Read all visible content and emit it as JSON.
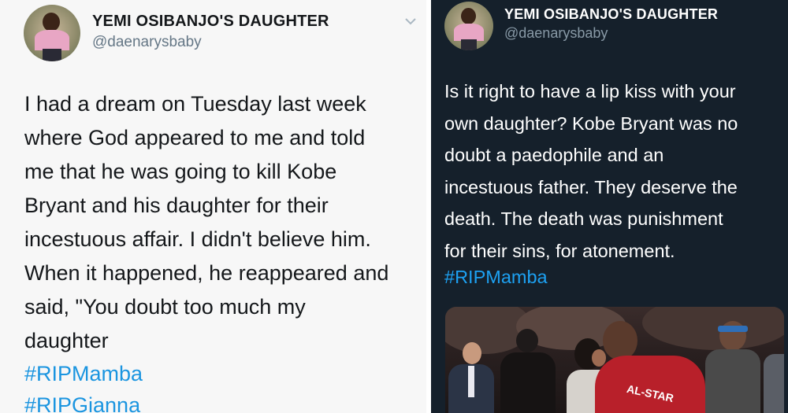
{
  "left_tweet": {
    "display_name": "YEMI OSIBANJO'S DAUGHTER",
    "handle": "@daenarysbaby",
    "text": "I had a dream on Tuesday last week\nwhere God appeared to me and told\nme that he was going to kill  Kobe\nBryant and his daughter for their\nincestuous affair. I didn't believe him.\nWhen it happened, he reappeared and\nsaid, \"You doubt too much my\ndaughter",
    "hashtags": [
      "#RIPMamba",
      "#RIPGianna"
    ],
    "menu_icon": "chevron-down-icon"
  },
  "right_tweet": {
    "display_name": "YEMI OSIBANJO'S DAUGHTER",
    "handle": "@daenarysbaby",
    "text": "Is it right to have a lip kiss with your\nown daughter? Kobe Bryant was no\ndoubt a paedophile and an\nincestuous father. They deserve the\ndeath. The death was punishment\nfor their sins, for atonement.",
    "hashtags": [
      "#RIPMamba"
    ],
    "photo": {
      "jersey_text": "AL-STAR"
    }
  },
  "colors": {
    "light_bg": "#f7f7f7",
    "dark_bg": "#15202b",
    "link_light": "#1b95e0",
    "link_dark": "#1da1f2",
    "handle_light": "#657786",
    "handle_dark": "#8899a6"
  }
}
